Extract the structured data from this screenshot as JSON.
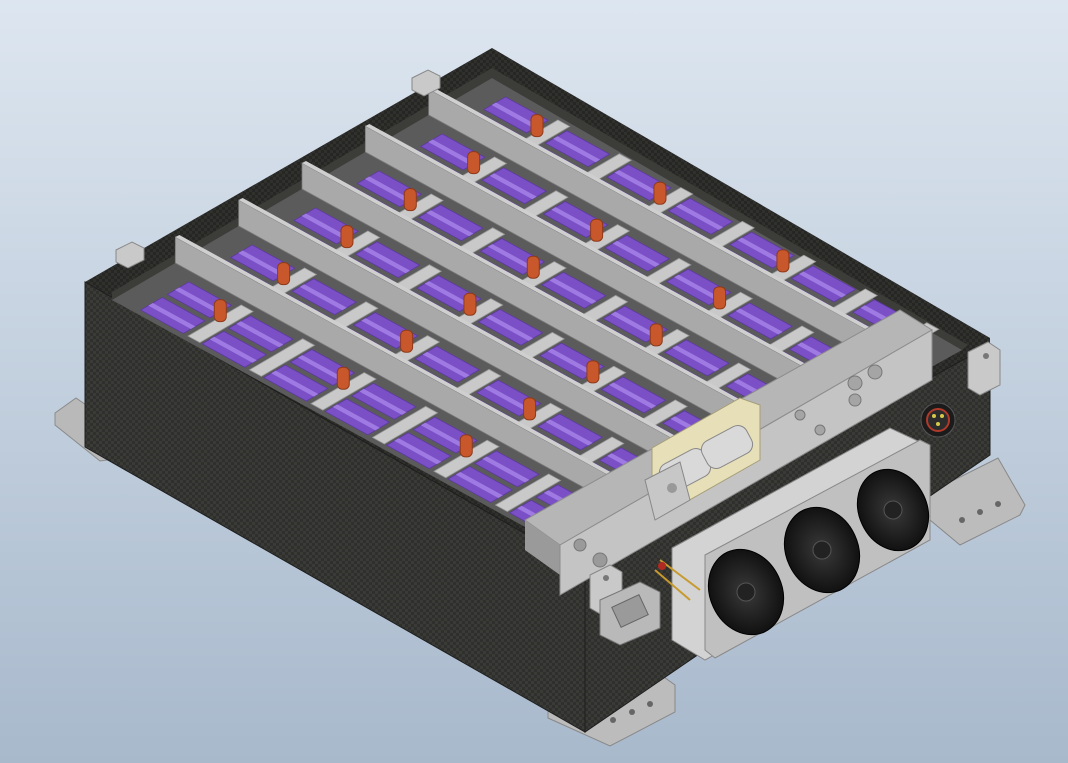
{
  "viewport": {
    "kind": "3d-cad-viewport",
    "background_top": "#dde6f0",
    "background_bottom": "#a8b9cc"
  },
  "model": {
    "subject": "battery-pack-enclosure",
    "enclosure_color": "#2f2f2d",
    "bay_count": 6,
    "colors": {
      "cell": "#7b4fc6",
      "cell_light": "#a07ae3",
      "busbar": "#c8582c",
      "holder": "#c9c9c9",
      "divider": "#a9a9a9",
      "mount": "#bdbdbd",
      "fan": "#1d1d1d",
      "connector_band": "#e7dfb8"
    }
  }
}
